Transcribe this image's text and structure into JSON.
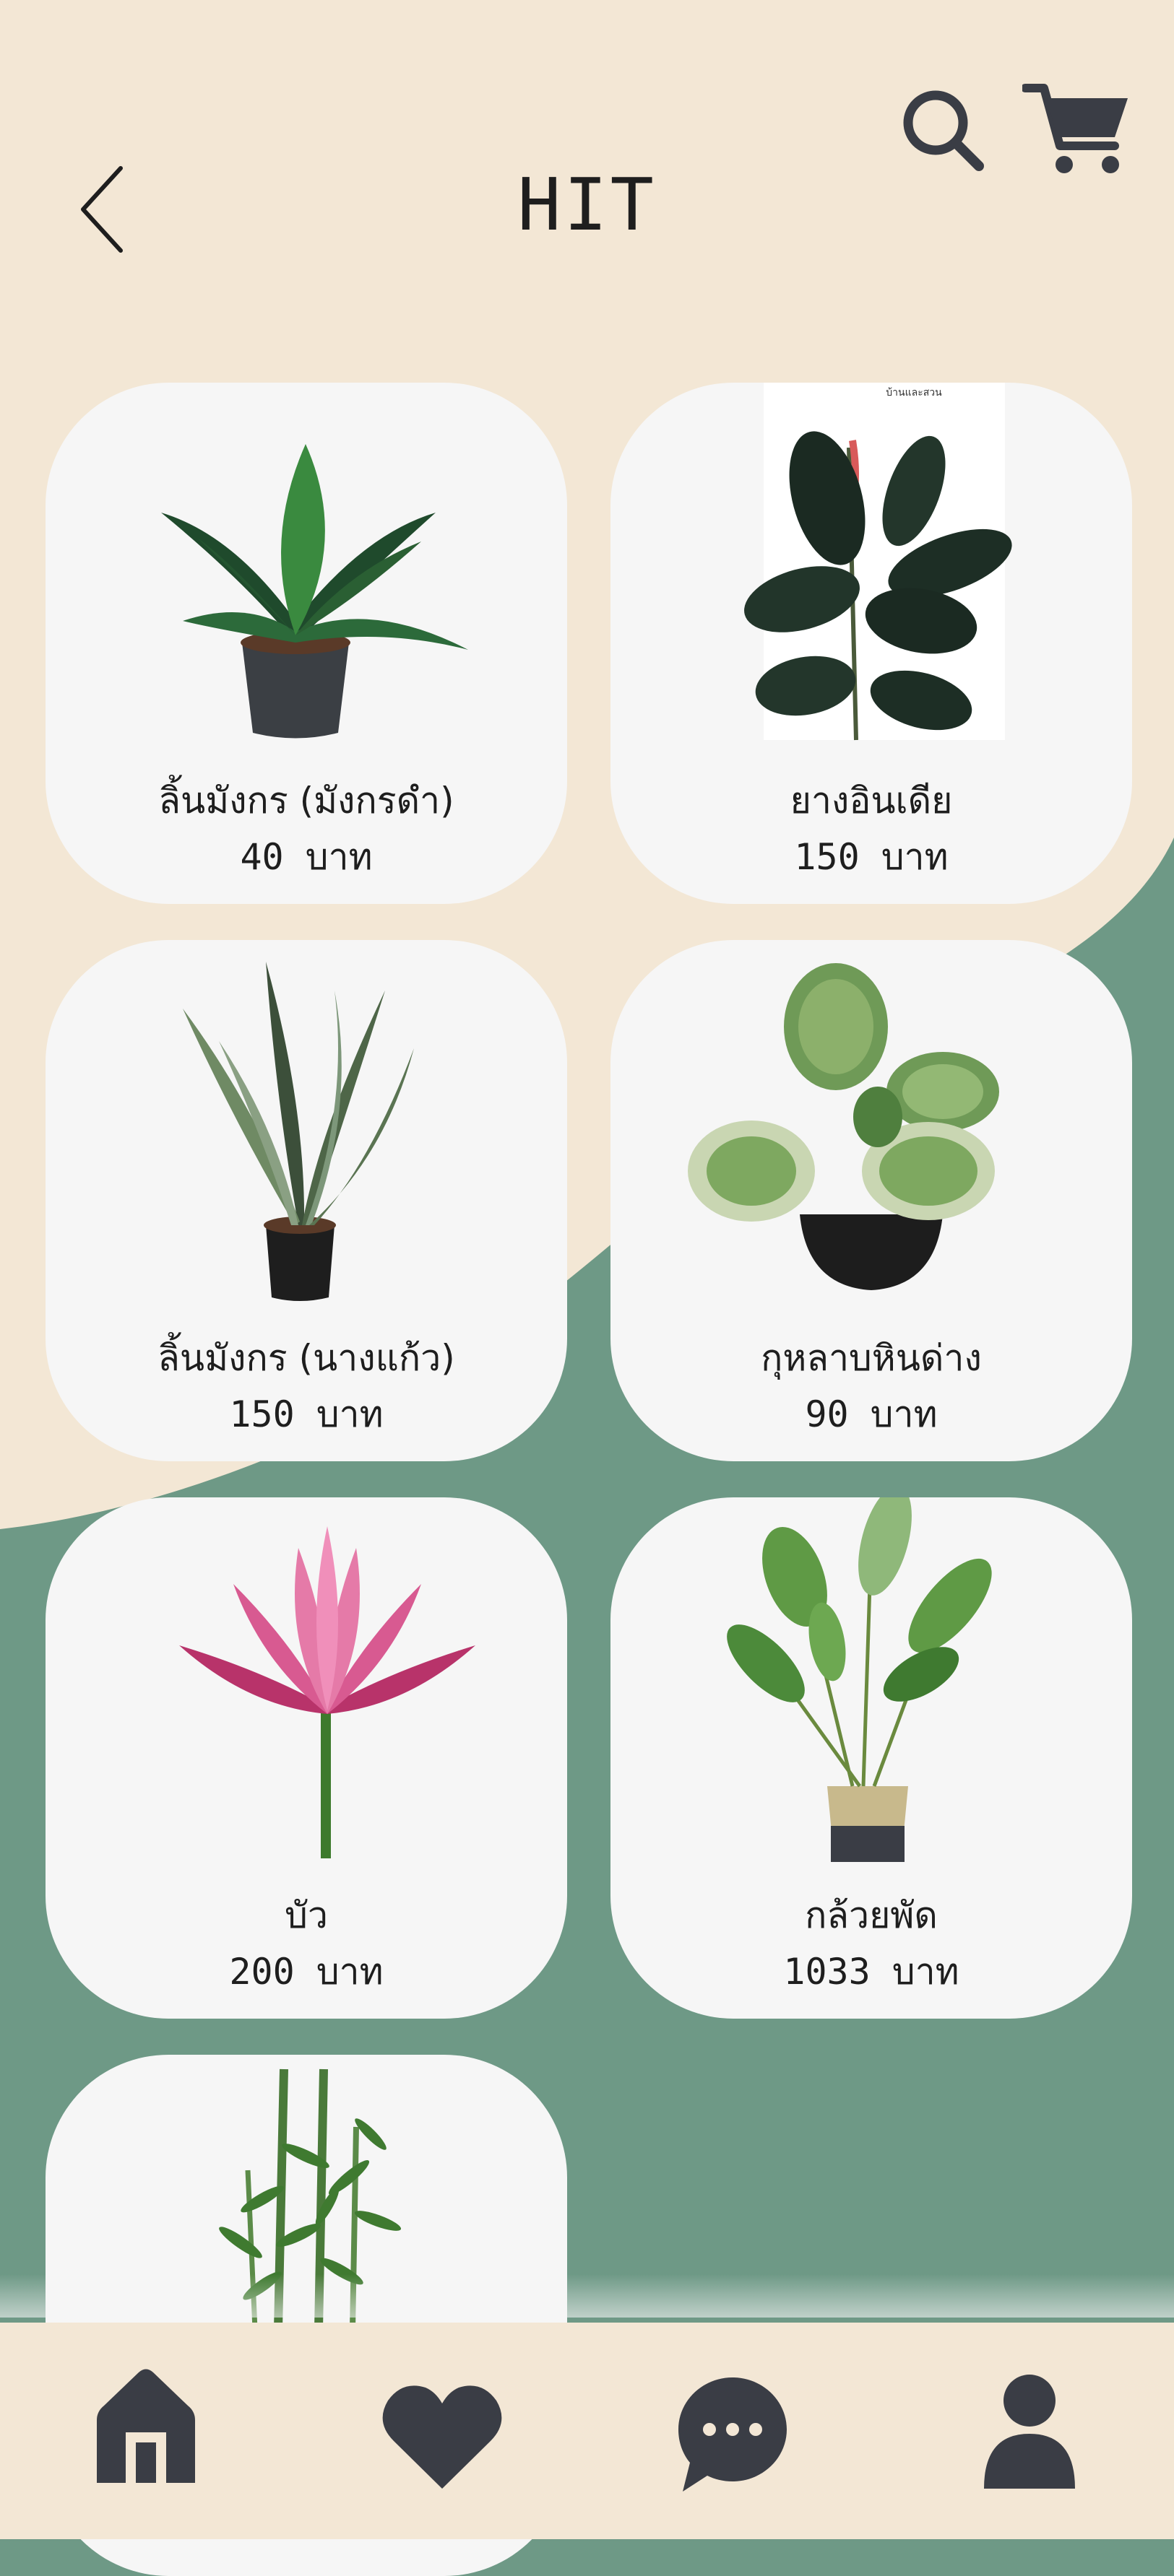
{
  "colors": {
    "cream": "#f3e7d5",
    "sage": "#6e9986",
    "card": "#f6f6f6",
    "icon": "#3a3d45",
    "text": "#1e1e1e"
  },
  "header": {
    "title": "HIT",
    "back_icon": "chevron-left-icon",
    "search_icon": "search-icon",
    "cart_icon": "cart-icon"
  },
  "products": [
    {
      "name": "ลิ้นมังกร (มังกรดำ)",
      "price": "40 บาท",
      "image": "dragon-tongue-plant"
    },
    {
      "name": "ยางอินเดีย",
      "price": "150 บาท",
      "image": "rubber-plant",
      "image_caption": "บ้านและสวน"
    },
    {
      "name": "ลิ้นมังกร (นางแก้ว)",
      "price": "150 บาท",
      "image": "snake-plant"
    },
    {
      "name": "กุหลาบหินด่าง",
      "price": "90 บาท",
      "image": "peperomia-plant"
    },
    {
      "name": "บัว",
      "price": "200 บาท",
      "image": "lotus-flower"
    },
    {
      "name": "กล้วยพัด",
      "price": "1033 บาท",
      "image": "bird-of-paradise-plant"
    },
    {
      "name": "",
      "price": "",
      "image": "bamboo-plant"
    }
  ],
  "bottom_nav": {
    "items": [
      "home-icon",
      "heart-icon",
      "chat-icon",
      "profile-icon"
    ]
  }
}
